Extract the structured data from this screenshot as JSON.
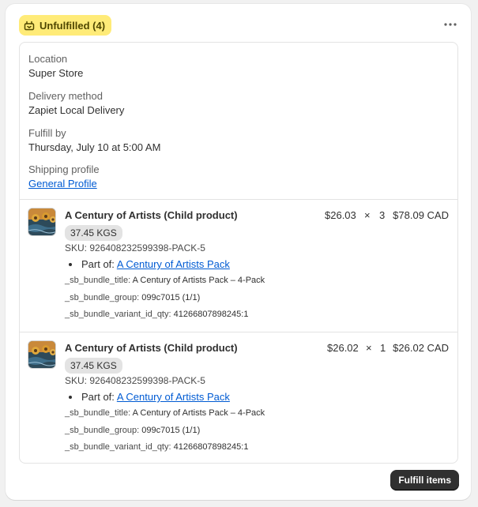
{
  "status_badge": {
    "label": "Unfulfilled (4)",
    "color": "#ffeb78",
    "icon": "fulfillment-box-icon"
  },
  "more_actions": {
    "icon": "more-horizontal-icon"
  },
  "location": {
    "label": "Location",
    "value": "Super Store"
  },
  "delivery": {
    "label": "Delivery method",
    "value": "Zapiet Local Delivery"
  },
  "fulfill_by": {
    "label": "Fulfill by",
    "value": "Thursday, July 10 at 5:00 AM"
  },
  "shipping_profile": {
    "label": "Shipping profile",
    "value": "General Profile"
  },
  "items": [
    {
      "title": "A Century of Artists (Child product)",
      "weight": "37.45 KGS",
      "sku": "SKU: 926408232599398-PACK-5",
      "part_of_label": "Part of:",
      "part_of_link": "A Century of Artists Pack",
      "bundle_title_key": "_sb_bundle_title:",
      "bundle_title_val": "A Century of Artists Pack – 4-Pack",
      "bundle_group_key": "_sb_bundle_group:",
      "bundle_group_val": "099c7015 (1/1)",
      "bundle_variant_key": "_sb_bundle_variant_id_qty:",
      "bundle_variant_val": "41266807898245:1",
      "unit_price": "$26.03",
      "times": "×",
      "qty": "3",
      "total": "$78.09 CAD"
    },
    {
      "title": "A Century of Artists (Child product)",
      "weight": "37.45 KGS",
      "sku": "SKU: 926408232599398-PACK-5",
      "part_of_label": "Part of:",
      "part_of_link": "A Century of Artists Pack",
      "bundle_title_key": "_sb_bundle_title:",
      "bundle_title_val": "A Century of Artists Pack – 4-Pack",
      "bundle_group_key": "_sb_bundle_group:",
      "bundle_group_val": "099c7015 (1/1)",
      "bundle_variant_key": "_sb_bundle_variant_id_qty:",
      "bundle_variant_val": "41266807898245:1",
      "unit_price": "$26.02",
      "times": "×",
      "qty": "1",
      "total": "$26.02 CAD"
    }
  ],
  "actions": {
    "fulfill_label": "Fulfill items"
  }
}
